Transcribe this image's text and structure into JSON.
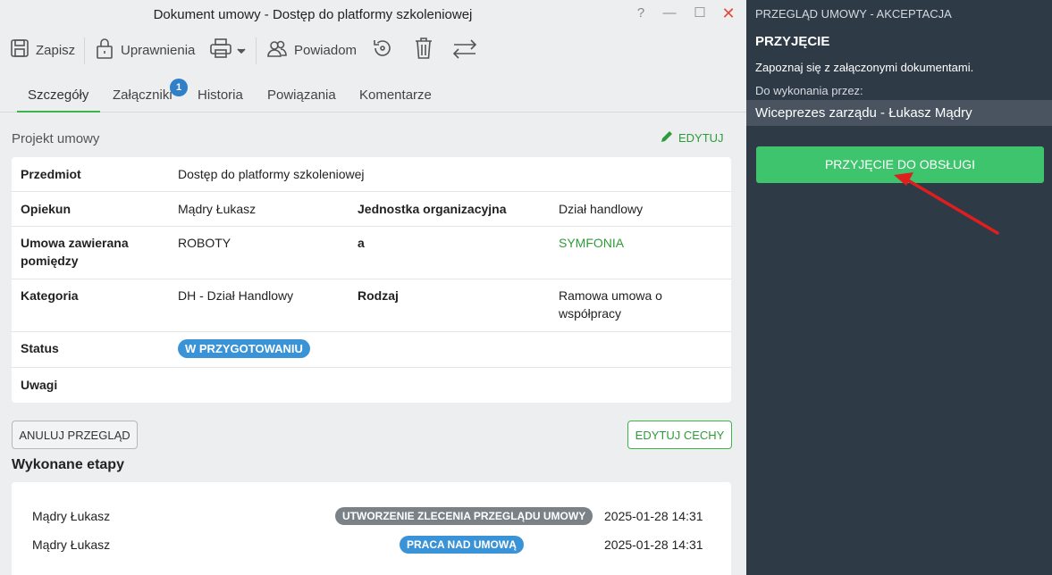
{
  "window": {
    "title": "Dokument umowy - Dostęp do platformy szkoleniowej",
    "help": "?",
    "minimize": "—",
    "maximize": "☐",
    "close": "✕"
  },
  "toolbar": {
    "save": "Zapisz",
    "permissions": "Uprawnienia",
    "notify": "Powiadom"
  },
  "tabs": [
    {
      "label": "Szczegóły"
    },
    {
      "label": "Załączniki",
      "badge": "1"
    },
    {
      "label": "Historia"
    },
    {
      "label": "Powiązania"
    },
    {
      "label": "Komentarze"
    }
  ],
  "section": {
    "title": "Projekt umowy",
    "edit": "EDYTUJ"
  },
  "details": {
    "subject_label": "Przedmiot",
    "subject_value": "Dostęp do platformy szkoleniowej",
    "owner_label": "Opiekun",
    "owner_value": "Mądry Łukasz",
    "unit_label": "Jednostka organizacyjna",
    "unit_value": "Dział handlowy",
    "parties_label_1": "Umowa zawierana",
    "parties_label_2": "pomiędzy",
    "party_a": "ROBOTY",
    "party_and": "a",
    "party_b": "SYMFONIA",
    "category_label": "Kategoria",
    "category_value": "DH - Dział Handlowy",
    "type_label": "Rodzaj",
    "type_value_1": "Ramowa umowa o",
    "type_value_2": "współpracy",
    "status_label": "Status",
    "status_value": "W PRZYGOTOWANIU",
    "notes_label": "Uwagi"
  },
  "buttons": {
    "cancel_review": "ANULUJ PRZEGLĄD",
    "edit_features": "EDYTUJ CECHY"
  },
  "steps": {
    "title": "Wykonane etapy",
    "items": [
      {
        "user": "Mądry Łukasz",
        "stage": "UTWORZENIE ZLECENIA PRZEGLĄDU UMOWY",
        "date": "2025-01-28 14:31",
        "color": "#7a8288"
      },
      {
        "user": "Mądry Łukasz",
        "stage": "PRACA NAD UMOWĄ",
        "date": "2025-01-28 14:31",
        "color": "#3a93d6"
      }
    ]
  },
  "panel": {
    "header": "PRZEGLĄD UMOWY - AKCEPTACJA",
    "title": "PRZYJĘCIE",
    "description": "Zapoznaj się z załączonymi dokumentami.",
    "assignee_label": "Do wykonania przez:",
    "assignee": "Wiceprezes zarządu - Łukasz Mądry",
    "accept_button": "PRZYJĘCIE DO OBSŁUGI"
  },
  "colors": {
    "accent_green": "#3bb54a",
    "panel_bg": "#2f3a47",
    "status_blue": "#3a93d6",
    "annotation_arrow": "#e01e1e"
  }
}
